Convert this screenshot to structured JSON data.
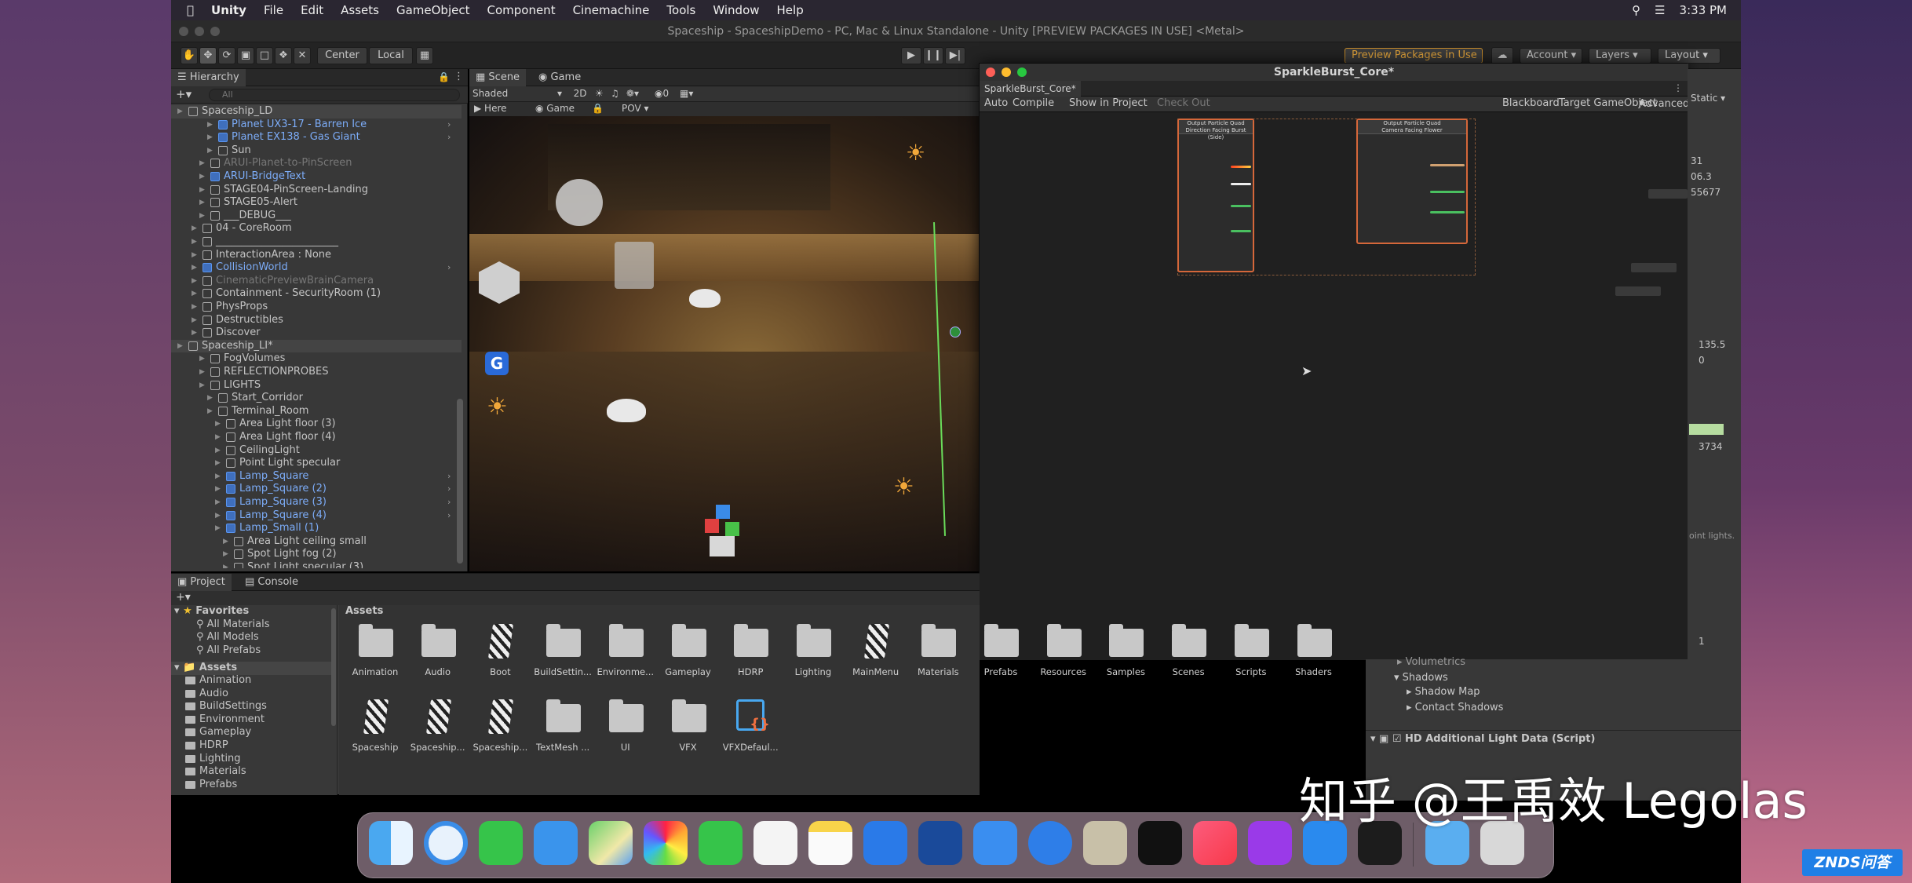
{
  "menubar": {
    "app_name": "Unity",
    "items": [
      "File",
      "Edit",
      "Assets",
      "GameObject",
      "Component",
      "Cinemachine",
      "Tools",
      "Window",
      "Help"
    ],
    "clock": "3:33 PM"
  },
  "window": {
    "title": "Spaceship - SpaceshipDemo - PC, Mac & Linux Standalone - Unity  [PREVIEW PACKAGES IN USE] <Metal>"
  },
  "toolbar": {
    "pivot": "Center",
    "space": "Local",
    "preview_packages": "Preview Packages in Use",
    "account": "Account",
    "layers": "Layers",
    "layout": "Layout"
  },
  "hierarchy": {
    "tab": "Hierarchy",
    "search_placeholder": "All",
    "rows": [
      {
        "label": "Spaceship_LD",
        "type": "scene"
      },
      {
        "label": "Planet UX3-17 - Barren Ice",
        "type": "prefab"
      },
      {
        "label": "Planet EX138 - Gas Giant",
        "type": "prefab"
      },
      {
        "label": "Sun",
        "type": "object"
      },
      {
        "label": "ARUI-Planet-to-PinScreen",
        "type": "disabled"
      },
      {
        "label": "ARUI-BridgeText",
        "type": "prefab"
      },
      {
        "label": "STAGE04-PinScreen-Landing",
        "type": "object"
      },
      {
        "label": "STAGE05-Alert",
        "type": "object"
      },
      {
        "label": "___DEBUG___",
        "type": "object"
      },
      {
        "label": "04 - CoreRoom",
        "type": "object"
      },
      {
        "label": "________________________",
        "type": "object"
      },
      {
        "label": "InteractionArea : None",
        "type": "object"
      },
      {
        "label": "CollisionWorld",
        "type": "prefab"
      },
      {
        "label": "CinematicPreviewBrainCamera",
        "type": "disabled"
      },
      {
        "label": "Containment - SecurityRoom (1)",
        "type": "object"
      },
      {
        "label": "PhysProps",
        "type": "object"
      },
      {
        "label": "Destructibles",
        "type": "object"
      },
      {
        "label": "Discover",
        "type": "object"
      },
      {
        "label": "Spaceship_LI*",
        "type": "scene"
      },
      {
        "label": "FogVolumes",
        "type": "object"
      },
      {
        "label": "REFLECTIONPROBES",
        "type": "object"
      },
      {
        "label": "LIGHTS",
        "type": "object"
      },
      {
        "label": "Start_Corridor",
        "type": "object"
      },
      {
        "label": "Terminal_Room",
        "type": "object"
      },
      {
        "label": "Area Light floor (3)",
        "type": "object"
      },
      {
        "label": "Area Light floor (4)",
        "type": "object"
      },
      {
        "label": "CeilingLight",
        "type": "object"
      },
      {
        "label": "Point Light specular",
        "type": "object"
      },
      {
        "label": "Lamp_Square",
        "type": "prefab"
      },
      {
        "label": "Lamp_Square (2)",
        "type": "prefab"
      },
      {
        "label": "Lamp_Square (3)",
        "type": "prefab"
      },
      {
        "label": "Lamp_Square (4)",
        "type": "prefab"
      },
      {
        "label": "Lamp_Small (1)",
        "type": "prefab"
      },
      {
        "label": "Area Light ceiling small",
        "type": "object"
      },
      {
        "label": "Spot Light fog (2)",
        "type": "object"
      },
      {
        "label": "Spot Light specular (3)",
        "type": "object"
      }
    ]
  },
  "scene": {
    "tab_scene": "Scene",
    "tab_game": "Game",
    "shading": "Shaded",
    "mode_2d": "2D",
    "hidden_count": "0",
    "cam_here": "Here",
    "cam_game": "Game",
    "cam_pov": "POV"
  },
  "vfx": {
    "title": "SparkleBurst_Core*",
    "tab": "SparkleBurst_Core*",
    "auto": "Auto",
    "compile": "Compile",
    "show_in_project": "Show in Project",
    "check_out": "Check Out",
    "blackboard": "Blackboard",
    "target": "Target GameObject",
    "advanced": "Advanced",
    "node_a_title": "Output Particle Quad",
    "node_a_sub": "Direction Facing Burst (Side)",
    "node_b_title": "Output Particle Quad",
    "node_b_sub": "Camera Facing Flower"
  },
  "inspector": {
    "static": "Static",
    "values": [
      "31",
      "06.3",
      "55677",
      "135.5",
      "0",
      "3734",
      "1"
    ],
    "note": "oint lights.",
    "volumetrics": "Volumetrics",
    "shadows": "Shadows",
    "shadow_map": "Shadow Map",
    "contact_shadows": "Contact Shadows",
    "light_data": "HD Additional Light Data (Script)"
  },
  "project": {
    "tab_project": "Project",
    "tab_console": "Console",
    "favorites": "Favorites",
    "fav_items": [
      "All Materials",
      "All Models",
      "All Prefabs"
    ],
    "assets_root": "Assets",
    "tree": [
      "Animation",
      "Audio",
      "BuildSettings",
      "Environment",
      "Gameplay",
      "HDRP",
      "Lighting",
      "Materials",
      "Prefabs"
    ],
    "breadcrumb": "Assets",
    "assets_row1": [
      "Animation",
      "Audio",
      "Boot",
      "BuildSettin...",
      "Environme...",
      "Gameplay",
      "HDRP",
      "Lighting",
      "MainMenu",
      "Materials",
      "Prefabs",
      "Resources",
      "Samples",
      "Scenes",
      "Scripts",
      "Shaders"
    ],
    "assets_row2": [
      "Spaceship",
      "Spaceship...",
      "Spaceship...",
      "TextMesh ...",
      "UI",
      "VFX",
      "VFXDefaul..."
    ]
  },
  "watermark": "知乎 @王禹效 Legolas",
  "corner_logo": "ZNDS问答"
}
